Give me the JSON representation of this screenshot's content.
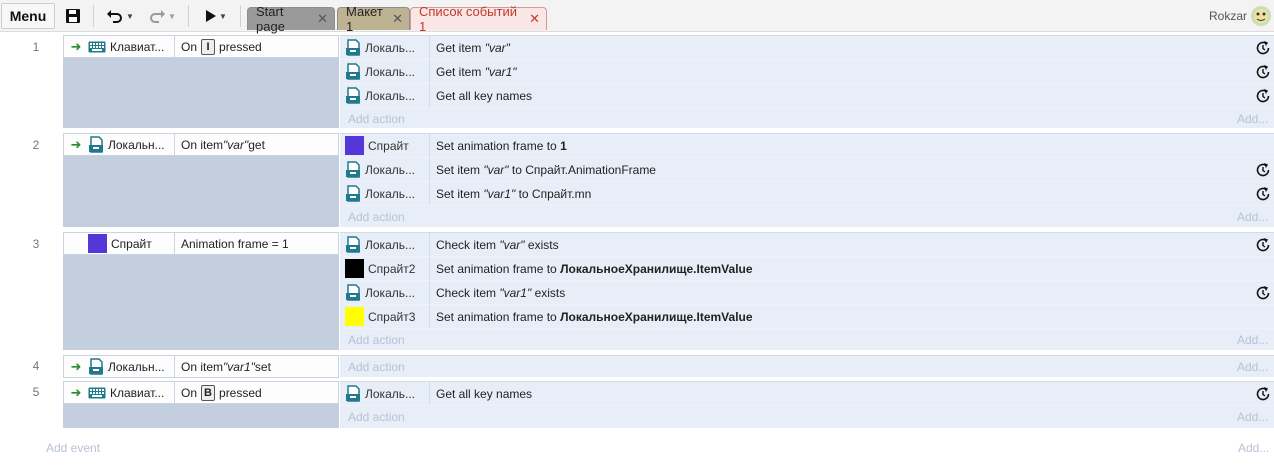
{
  "toolbar": {
    "menu_label": "Menu",
    "save_icon": "save-icon",
    "undo_icon": "undo-icon",
    "redo_icon": "redo-icon",
    "play_icon": "play-icon"
  },
  "tabs": [
    {
      "label": "Start page",
      "close": "✕"
    },
    {
      "label": "Макет 1",
      "close": "✕"
    },
    {
      "label": "Список событий 1",
      "close": "✕"
    }
  ],
  "user": {
    "name": "Rokzar"
  },
  "colors": {
    "sprite": "#5536d6",
    "sprite2": "#000000",
    "sprite3": "#ffff00",
    "storage_icon": "#1f7a8c"
  },
  "events": [
    {
      "number": "1",
      "condition": {
        "object": "Клавиат...",
        "pre": "On",
        "key": "I",
        "post": "pressed"
      },
      "actions": [
        {
          "object": "Локаль...",
          "pre": "Get item ",
          "q": "\"var\"",
          "post": ""
        },
        {
          "object": "Локаль...",
          "pre": "Get item ",
          "q": "\"var1\"",
          "post": ""
        },
        {
          "object": "Локаль...",
          "pre": "Get all key names",
          "q": "",
          "post": ""
        }
      ],
      "add_action": "Add action",
      "add_right": "Add..."
    },
    {
      "number": "2",
      "condition": {
        "object": "Локальн...",
        "pre": "On item ",
        "q": "\"var\"",
        "post": " get"
      },
      "actions": [
        {
          "object": "Спрайт",
          "pre": "Set animation frame to ",
          "bold": "1"
        },
        {
          "object": "Локаль...",
          "pre": "Set item ",
          "q": "\"var\"",
          "post": " to Спрайт.AnimationFrame"
        },
        {
          "object": "Локаль...",
          "pre": "Set item ",
          "q": "\"var1\"",
          "post": " to Спрайт.mn"
        }
      ],
      "add_action": "Add action",
      "add_right": "Add..."
    },
    {
      "number": "3",
      "condition": {
        "object": "Спрайт",
        "text": "Animation frame = 1"
      },
      "actions": [
        {
          "object": "Локаль...",
          "pre": "Check item ",
          "q": "\"var\"",
          "post": " exists"
        },
        {
          "object": "Спрайт2",
          "pre": "Set animation frame to ",
          "bold": "ЛокальноеХранилище.ItemValue"
        },
        {
          "object": "Локаль...",
          "pre": "Check item ",
          "q": "\"var1\"",
          "post": " exists"
        },
        {
          "object": "Спрайт3",
          "pre": "Set animation frame to ",
          "bold": "ЛокальноеХранилище.ItemValue"
        }
      ],
      "add_action": "Add action",
      "add_right": "Add..."
    },
    {
      "number": "4",
      "condition": {
        "object": "Локальн...",
        "pre": "On item ",
        "q": "\"var1\"",
        "post": " set"
      },
      "actions": [],
      "add_action": "Add action",
      "add_right": "Add..."
    },
    {
      "number": "5",
      "condition": {
        "object": "Клавиат...",
        "pre": "On",
        "key": "B",
        "post": "pressed"
      },
      "actions": [
        {
          "object": "Локаль...",
          "pre": "Get all key names",
          "q": "",
          "post": ""
        }
      ],
      "add_action": "Add action",
      "add_right": "Add..."
    }
  ],
  "footer": {
    "add_event": "Add event",
    "add_right": "Add..."
  }
}
